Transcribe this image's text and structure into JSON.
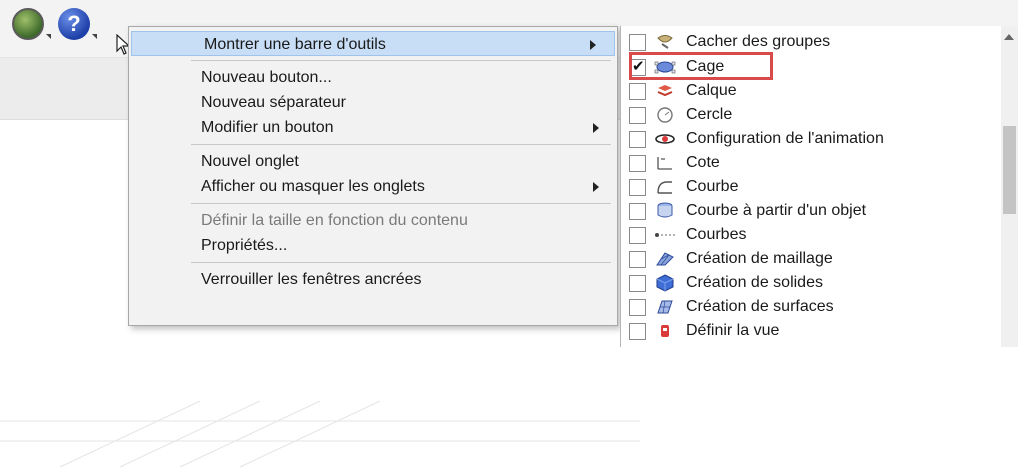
{
  "toolbar": {
    "icons": [
      "globe-icon",
      "help-icon"
    ],
    "help_glyph": "?"
  },
  "context_menu": {
    "items": [
      {
        "label": "Montrer une barre d'outils",
        "submenu": true,
        "highlighted": true
      },
      {
        "label": "Nouveau bouton...",
        "submenu": false
      },
      {
        "label": "Nouveau séparateur",
        "submenu": false
      },
      {
        "label": "Modifier un bouton",
        "submenu": true
      },
      {
        "label": "Nouvel onglet",
        "submenu": false
      },
      {
        "label": "Afficher ou masquer les onglets",
        "submenu": true
      },
      {
        "label": "Définir la taille en fonction du contenu",
        "submenu": false,
        "disabled": true
      },
      {
        "label": "Propriétés...",
        "submenu": false
      },
      {
        "label": "Verrouiller les fenêtres ancrées",
        "submenu": false
      }
    ]
  },
  "toolbar_list": {
    "items": [
      {
        "label": "Cacher des groupes",
        "checked": false,
        "icon": "hide-groups-icon"
      },
      {
        "label": "Cage",
        "checked": true,
        "icon": "cage-icon"
      },
      {
        "label": "Calque",
        "checked": false,
        "icon": "layer-icon"
      },
      {
        "label": "Cercle",
        "checked": false,
        "icon": "circle-icon"
      },
      {
        "label": "Configuration de l'animation",
        "checked": false,
        "icon": "animation-icon"
      },
      {
        "label": "Cote",
        "checked": false,
        "icon": "dimension-icon"
      },
      {
        "label": "Courbe",
        "checked": false,
        "icon": "curve-icon"
      },
      {
        "label": "Courbe à partir d'un objet",
        "checked": false,
        "icon": "curve-from-object-icon"
      },
      {
        "label": "Courbes",
        "checked": false,
        "icon": "curves-icon"
      },
      {
        "label": "Création de maillage",
        "checked": false,
        "icon": "mesh-creation-icon"
      },
      {
        "label": "Création de solides",
        "checked": false,
        "icon": "solid-creation-icon"
      },
      {
        "label": "Création de surfaces",
        "checked": false,
        "icon": "surface-creation-icon"
      },
      {
        "label": "Définir la vue",
        "checked": false,
        "icon": "set-view-icon"
      }
    ]
  },
  "colors": {
    "highlight": "#c8ddf6",
    "callout": "#d94b4b"
  }
}
